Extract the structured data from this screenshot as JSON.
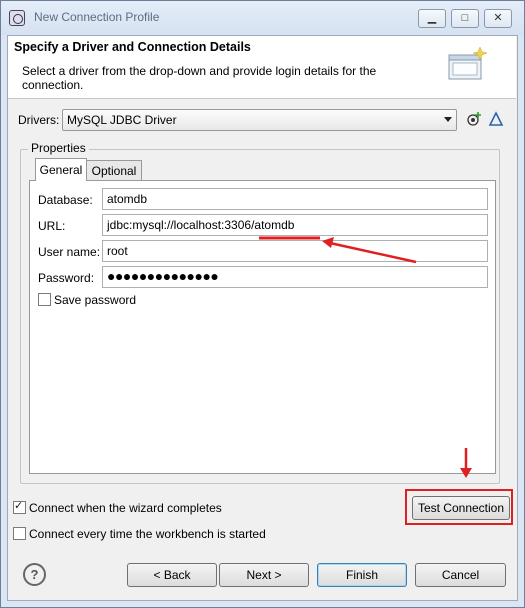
{
  "window": {
    "title": "New Connection Profile",
    "controls": {
      "minimize": "▁",
      "maximize": "□",
      "close": "✕"
    }
  },
  "header": {
    "title": "Specify a Driver and Connection Details",
    "description": "Select a driver from the drop-down and provide login details for the connection."
  },
  "drivers": {
    "label": "Drivers:",
    "selected": "MySQL JDBC Driver",
    "new_driver_icon": "new-driver-definition-icon",
    "edit_driver_icon": "edit-driver-definition-icon"
  },
  "properties": {
    "group_label": "Properties",
    "tabs": [
      {
        "label": "General",
        "active": true
      },
      {
        "label": "Optional",
        "active": false
      }
    ],
    "fields": {
      "database": {
        "label": "Database:",
        "value": "atomdb"
      },
      "url": {
        "label": "URL:",
        "value": "jdbc:mysql://localhost:3306/atomdb"
      },
      "username": {
        "label": "User name:",
        "value": "root"
      },
      "password": {
        "label": "Password:",
        "value": "●●●●●●●●●●●●●●"
      }
    },
    "save_password": {
      "label": "Save password",
      "checked": false
    }
  },
  "options": {
    "connect_on_finish": {
      "label": "Connect when the wizard completes",
      "checked": true
    },
    "connect_every_time": {
      "label": "Connect every time the workbench is started",
      "checked": false
    }
  },
  "buttons": {
    "test_connection": "Test Connection",
    "back": "< Back",
    "next": "Next >",
    "finish": "Finish",
    "cancel": "Cancel"
  },
  "help": {
    "icon": "help-icon",
    "glyph": "?"
  },
  "colors": {
    "annotation": "#e02020",
    "titlebar": "#d6e2f1",
    "dialog_background": "#f0f0f0"
  }
}
